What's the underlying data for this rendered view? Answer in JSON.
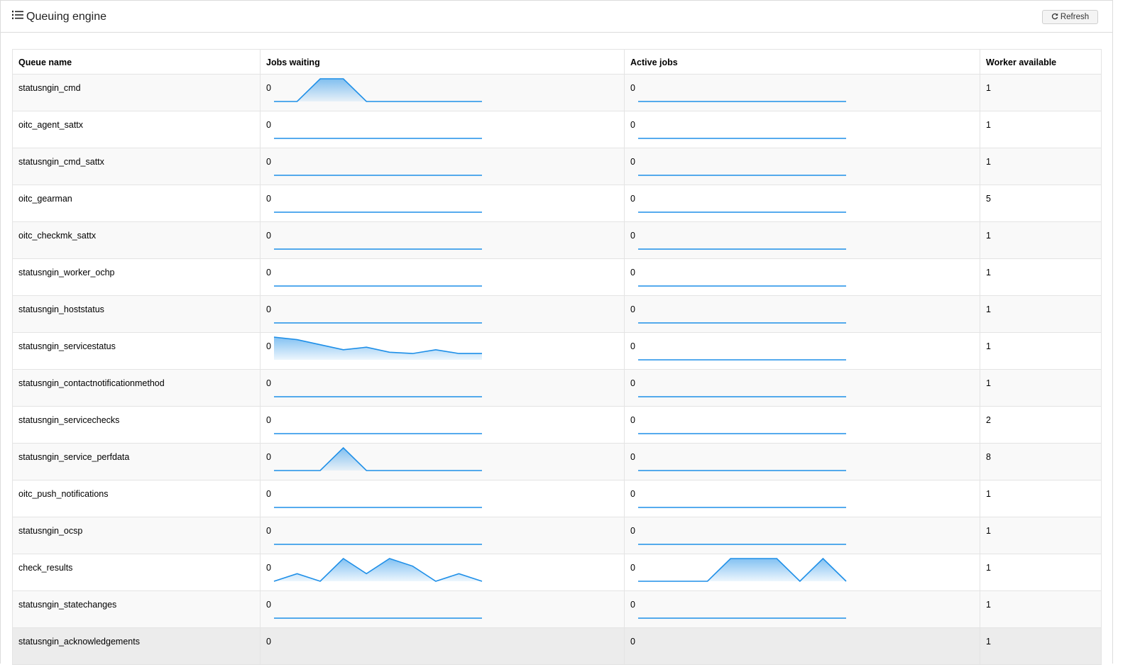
{
  "header": {
    "title": "Queuing engine",
    "refresh_label": "Refresh"
  },
  "columns": [
    "Queue name",
    "Jobs waiting",
    "Active jobs",
    "Worker available"
  ],
  "accent_color": "#1e8fe8",
  "rows": [
    {
      "name": "statusngin_cmd",
      "jobs_waiting": "0",
      "active_jobs": "0",
      "workers": "1",
      "waiting_history": [
        0,
        0,
        1,
        1,
        0,
        0,
        0,
        0,
        0,
        0
      ],
      "active_history": [
        0,
        0,
        0,
        0,
        0,
        0,
        0,
        0,
        0,
        0
      ]
    },
    {
      "name": "oitc_agent_sattx",
      "jobs_waiting": "0",
      "active_jobs": "0",
      "workers": "1",
      "waiting_history": [
        0,
        0,
        0,
        0,
        0,
        0,
        0,
        0,
        0,
        0
      ],
      "active_history": [
        0,
        0,
        0,
        0,
        0,
        0,
        0,
        0,
        0,
        0
      ]
    },
    {
      "name": "statusngin_cmd_sattx",
      "jobs_waiting": "0",
      "active_jobs": "0",
      "workers": "1",
      "waiting_history": [
        0,
        0,
        0,
        0,
        0,
        0,
        0,
        0,
        0,
        0
      ],
      "active_history": [
        0,
        0,
        0,
        0,
        0,
        0,
        0,
        0,
        0,
        0
      ]
    },
    {
      "name": "oitc_gearman",
      "jobs_waiting": "0",
      "active_jobs": "0",
      "workers": "5",
      "waiting_history": [
        0,
        0,
        0,
        0,
        0,
        0,
        0,
        0,
        0,
        0
      ],
      "active_history": [
        0,
        0,
        0,
        0,
        0,
        0,
        0,
        0,
        0,
        0
      ]
    },
    {
      "name": "oitc_checkmk_sattx",
      "jobs_waiting": "0",
      "active_jobs": "0",
      "workers": "1",
      "waiting_history": [
        0,
        0,
        0,
        0,
        0,
        0,
        0,
        0,
        0,
        0
      ],
      "active_history": [
        0,
        0,
        0,
        0,
        0,
        0,
        0,
        0,
        0,
        0
      ]
    },
    {
      "name": "statusngin_worker_ochp",
      "jobs_waiting": "0",
      "active_jobs": "0",
      "workers": "1",
      "waiting_history": [
        0,
        0,
        0,
        0,
        0,
        0,
        0,
        0,
        0,
        0
      ],
      "active_history": [
        0,
        0,
        0,
        0,
        0,
        0,
        0,
        0,
        0,
        0
      ]
    },
    {
      "name": "statusngin_hoststatus",
      "jobs_waiting": "0",
      "active_jobs": "0",
      "workers": "1",
      "waiting_history": [
        0,
        0,
        0,
        0,
        0,
        0,
        0,
        0,
        0,
        0
      ],
      "active_history": [
        0,
        0,
        0,
        0,
        0,
        0,
        0,
        0,
        0,
        0
      ]
    },
    {
      "name": "statusngin_servicestatus",
      "jobs_waiting": "0",
      "active_jobs": "0",
      "workers": "1",
      "waiting_history": [
        9,
        8,
        6,
        4,
        5,
        3,
        2.5,
        4,
        2.5,
        2.5
      ],
      "active_history": [
        0,
        0,
        0,
        0,
        0,
        0,
        0,
        0,
        0,
        0
      ]
    },
    {
      "name": "statusngin_contactnotificationmethod",
      "jobs_waiting": "0",
      "active_jobs": "0",
      "workers": "1",
      "waiting_history": [
        0,
        0,
        0,
        0,
        0,
        0,
        0,
        0,
        0,
        0
      ],
      "active_history": [
        0,
        0,
        0,
        0,
        0,
        0,
        0,
        0,
        0,
        0
      ]
    },
    {
      "name": "statusngin_servicechecks",
      "jobs_waiting": "0",
      "active_jobs": "0",
      "workers": "2",
      "waiting_history": [
        0,
        0,
        0,
        0,
        0,
        0,
        0,
        0,
        0,
        0
      ],
      "active_history": [
        0,
        0,
        0,
        0,
        0,
        0,
        0,
        0,
        0,
        0
      ]
    },
    {
      "name": "statusngin_service_perfdata",
      "jobs_waiting": "0",
      "active_jobs": "0",
      "workers": "8",
      "waiting_history": [
        0,
        0,
        0,
        1,
        0,
        0,
        0,
        0,
        0,
        0
      ],
      "active_history": [
        0,
        0,
        0,
        0,
        0,
        0,
        0,
        0,
        0,
        0
      ]
    },
    {
      "name": "oitc_push_notifications",
      "jobs_waiting": "0",
      "active_jobs": "0",
      "workers": "1",
      "waiting_history": [
        0,
        0,
        0,
        0,
        0,
        0,
        0,
        0,
        0,
        0
      ],
      "active_history": [
        0,
        0,
        0,
        0,
        0,
        0,
        0,
        0,
        0,
        0
      ]
    },
    {
      "name": "statusngin_ocsp",
      "jobs_waiting": "0",
      "active_jobs": "0",
      "workers": "1",
      "waiting_history": [
        0,
        0,
        0,
        0,
        0,
        0,
        0,
        0,
        0,
        0
      ],
      "active_history": [
        0,
        0,
        0,
        0,
        0,
        0,
        0,
        0,
        0,
        0
      ]
    },
    {
      "name": "check_results",
      "jobs_waiting": "0",
      "active_jobs": "0",
      "workers": "1",
      "waiting_history": [
        0,
        1,
        0,
        3,
        1,
        3,
        2,
        0,
        1,
        0
      ],
      "active_history": [
        0,
        0,
        0,
        0,
        1,
        1,
        1,
        0,
        1,
        0
      ]
    },
    {
      "name": "statusngin_statechanges",
      "jobs_waiting": "0",
      "active_jobs": "0",
      "workers": "1",
      "waiting_history": [
        0,
        0,
        0,
        0,
        0,
        0,
        0,
        0,
        0,
        0
      ],
      "active_history": [
        0,
        0,
        0,
        0,
        0,
        0,
        0,
        0,
        0,
        0
      ]
    },
    {
      "name": "statusngin_acknowledgements",
      "jobs_waiting": "0",
      "active_jobs": "0",
      "workers": "1",
      "waiting_history": [],
      "active_history": []
    }
  ]
}
